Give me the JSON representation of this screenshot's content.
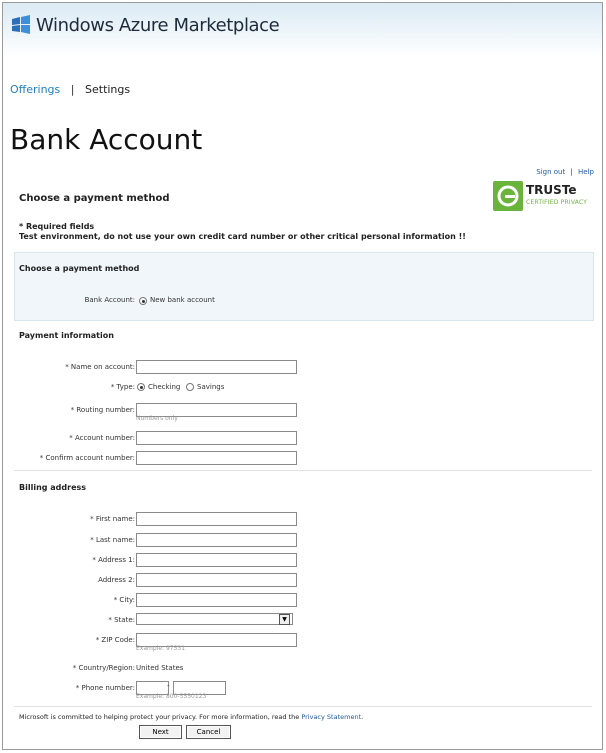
{
  "header": {
    "brand": "Windows Azure Marketplace",
    "brand_sup": "®"
  },
  "nav": {
    "offerings": "Offerings",
    "separator": "|",
    "settings": "Settings"
  },
  "page": {
    "title": "Bank Account"
  },
  "util": {
    "sign_out": "Sign out",
    "separator": "|",
    "help": "Help"
  },
  "section_payment_method": "Choose a payment method",
  "truste": {
    "name": "TRUSTe",
    "tagline": "CERTIFIED PRIVACY"
  },
  "required_note": "* Required fields",
  "test_warning": "Test environment, do not use your own credit card number or other critical personal information !!",
  "payment_panel": {
    "heading": "Choose a payment method",
    "bank_account_label": "Bank Account:",
    "new_bank_account": "New bank account",
    "selected": true
  },
  "payment_info": {
    "heading": "Payment information",
    "name_label": "* Name on account:",
    "type_label": "* Type:",
    "type_options": [
      "Checking",
      "Savings"
    ],
    "type_selected": "Checking",
    "routing_label": "* Routing number:",
    "routing_hint": "Numbers only",
    "account_label": "* Account number:",
    "confirm_label": "* Confirm account number:"
  },
  "billing": {
    "heading": "Billing address",
    "first_name": "* First name:",
    "last_name": "* Last name:",
    "address1": "* Address 1:",
    "address2": "Address 2:",
    "city": "* City:",
    "state": "* State:",
    "zip": "* ZIP Code:",
    "zip_hint": "Example: 97531",
    "country_label": "* Country/Region:",
    "country_value": "United States",
    "phone": "* Phone number:",
    "phone_dash": "-",
    "phone_hint": "Example: 800-5550123"
  },
  "footer": {
    "privacy_text": "Microsoft is committed to helping protect your privacy. For more information, read the",
    "privacy_link": "Privacy Statement",
    "privacy_end": "."
  },
  "buttons": {
    "next": "Next",
    "cancel": "Cancel"
  },
  "colors": {
    "link": "#1f7fc0",
    "truste_green": "#6bb43c",
    "panel_bg": "#f0f6fa"
  }
}
